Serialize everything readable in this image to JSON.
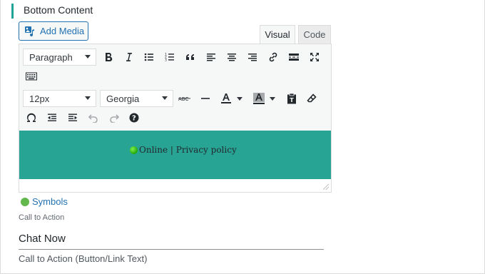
{
  "section": {
    "title": "Bottom Content"
  },
  "media": {
    "add_label": "Add Media"
  },
  "tabs": {
    "visual": "Visual",
    "code": "Code"
  },
  "toolbar": {
    "format_select": "Paragraph",
    "fontsize_select": "12px",
    "fontfamily_select": "Georgia"
  },
  "content": {
    "status_text": "Online | Privacy policy",
    "background_color": "#28a495"
  },
  "symbols": {
    "label": "Symbols"
  },
  "cta": {
    "label": "Call to Action",
    "value": "Chat Now",
    "help": "Call to Action (Button/Link Text)"
  },
  "colors": {
    "accent": "#20a297",
    "link": "#2271b1"
  }
}
